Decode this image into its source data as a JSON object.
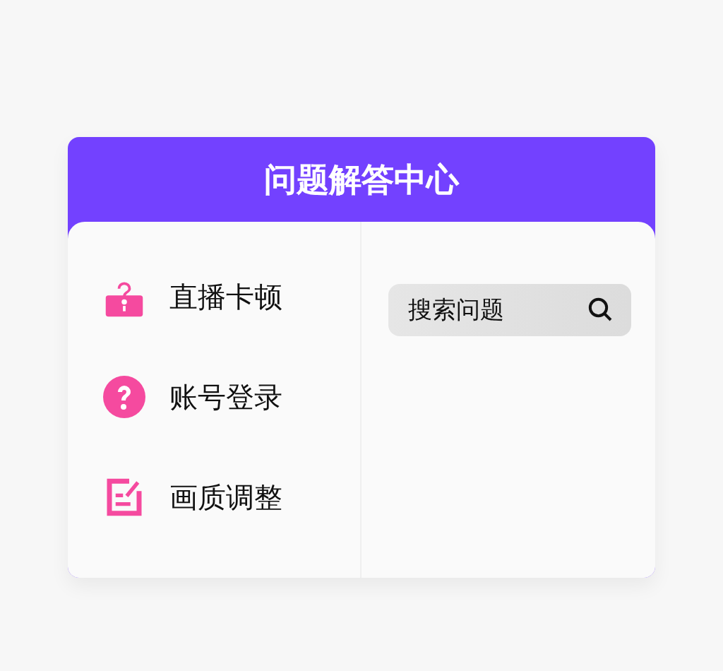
{
  "header": {
    "title": "问题解答中心"
  },
  "menu": [
    {
      "label": "直播卡顿"
    },
    {
      "label": "账号登录"
    },
    {
      "label": "画质调整"
    }
  ],
  "search": {
    "placeholder": "搜索问题"
  }
}
